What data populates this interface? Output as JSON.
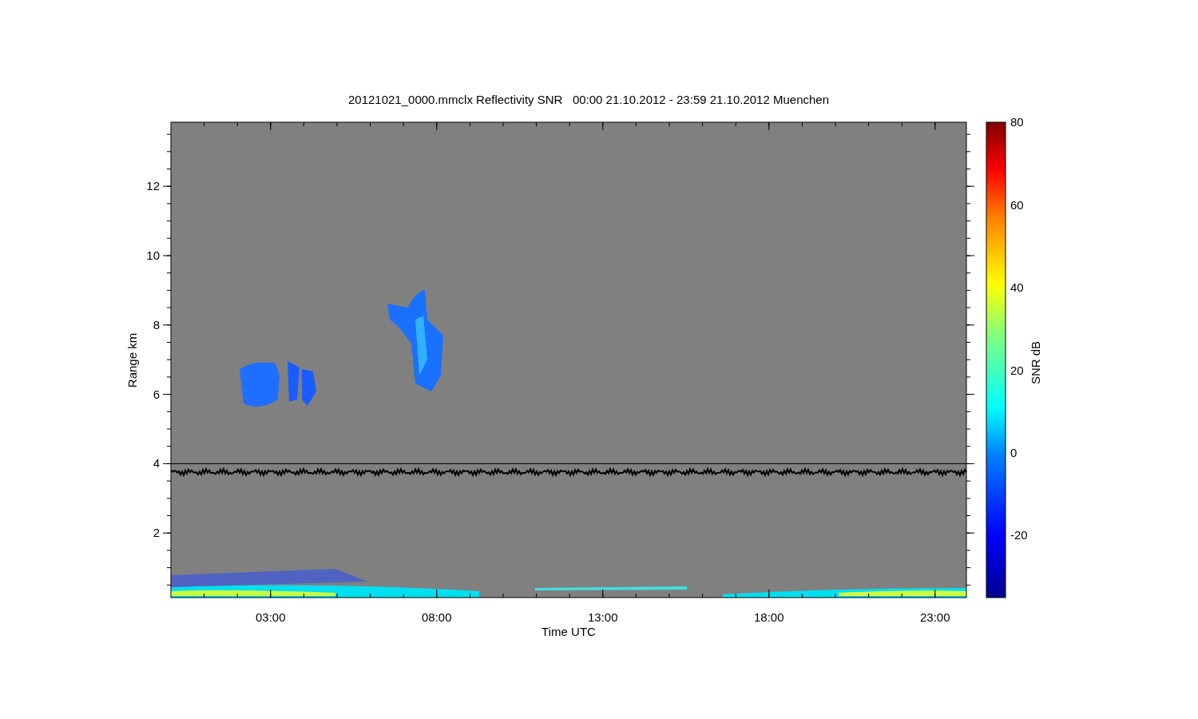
{
  "title": "20121021_0000.mmclx Reflectivity SNR   00:00 21.10.2012 - 23:59 21.10.2012 Muenchen",
  "plot": {
    "xlabel": "Time UTC",
    "ylabel": "Range km",
    "xtick_labels": [
      "03:00",
      "08:00",
      "13:00",
      "18:00",
      "23:00"
    ],
    "ytick_labels": [
      "12",
      "10",
      "8",
      "6",
      "4",
      "2"
    ]
  },
  "colorbar": {
    "label": "SNR dB",
    "tick_labels": [
      "80",
      "60",
      "40",
      "20",
      "0",
      "-20"
    ]
  }
}
